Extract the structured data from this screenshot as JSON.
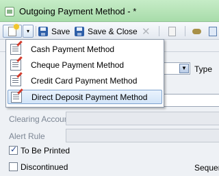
{
  "window": {
    "title": "Outgoing Payment Method - *"
  },
  "toolbar": {
    "save_label": "Save",
    "save_close_label": "Save & Close",
    "delete_label": "✕",
    "new_dropdown_arrow": "▾"
  },
  "new_menu": {
    "items": [
      {
        "label": "Cash Payment Method",
        "selected": false
      },
      {
        "label": "Cheque Payment Method",
        "selected": false
      },
      {
        "label": "Credit Card Payment Method",
        "selected": false
      },
      {
        "label": "Direct Deposit Payment Method",
        "selected": true
      }
    ]
  },
  "form": {
    "type_label": "Type",
    "type_dropdown_arrow": "▼",
    "clearing_account_label": "Clearing Account",
    "alert_rule_label": "Alert Rule",
    "to_be_printed_label": "To Be Printed",
    "to_be_printed_checked": true,
    "discontinued_label": "Discontinued",
    "discontinued_checked": false,
    "sequence_label": "Sequen"
  },
  "colors": {
    "titlebar": "#a8dcaa",
    "selection": "#d2e4f8",
    "selection_border": "#7da2ce"
  }
}
